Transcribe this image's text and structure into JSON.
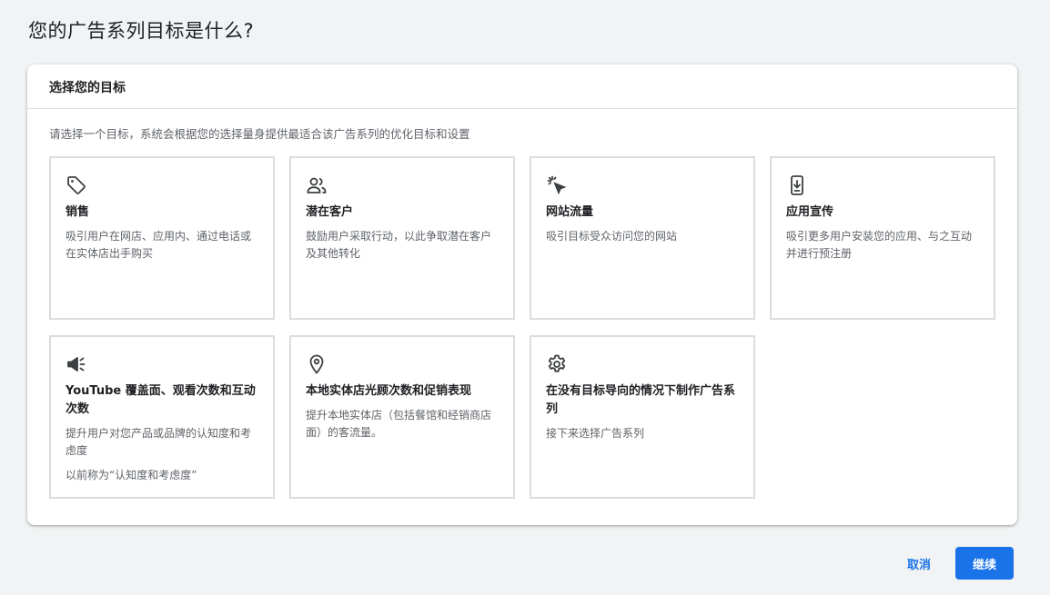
{
  "page": {
    "title": "您的广告系列目标是什么?"
  },
  "card": {
    "header": "选择您的目标",
    "description": "请选择一个目标，系统会根据您的选择量身提供最适合该广告系列的优化目标和设置"
  },
  "goals": [
    {
      "icon": "tag-icon",
      "title": "销售",
      "desc": "吸引用户在网店、应用内、通过电话或在实体店出手购买",
      "note": ""
    },
    {
      "icon": "people-icon",
      "title": "潜在客户",
      "desc": "鼓励用户采取行动，以此争取潜在客户及其他转化",
      "note": ""
    },
    {
      "icon": "cursor-click-icon",
      "title": "网站流量",
      "desc": "吸引目标受众访问您的网站",
      "note": ""
    },
    {
      "icon": "phone-download-icon",
      "title": "应用宣传",
      "desc": "吸引更多用户安装您的应用、与之互动并进行预注册",
      "note": ""
    },
    {
      "icon": "megaphone-icon",
      "title": "YouTube 覆盖面、观看次数和互动次数",
      "desc": "提升用户对您产品或品牌的认知度和考虑度",
      "note": "以前称为“认知度和考虑度”"
    },
    {
      "icon": "location-pin-icon",
      "title": "本地实体店光顾次数和促销表现",
      "desc": "提升本地实体店（包括餐馆和经销商店面）的客流量。",
      "note": ""
    },
    {
      "icon": "gear-icon",
      "title": "在没有目标导向的情况下制作广告系列",
      "desc": "接下来选择广告系列",
      "note": ""
    }
  ],
  "footer": {
    "cancel_label": "取消",
    "continue_label": "继续"
  },
  "colors": {
    "accent": "#1a73e8",
    "background": "#f1f3f4",
    "tile_border": "#dadce0",
    "secondary_text": "#5f6368"
  }
}
